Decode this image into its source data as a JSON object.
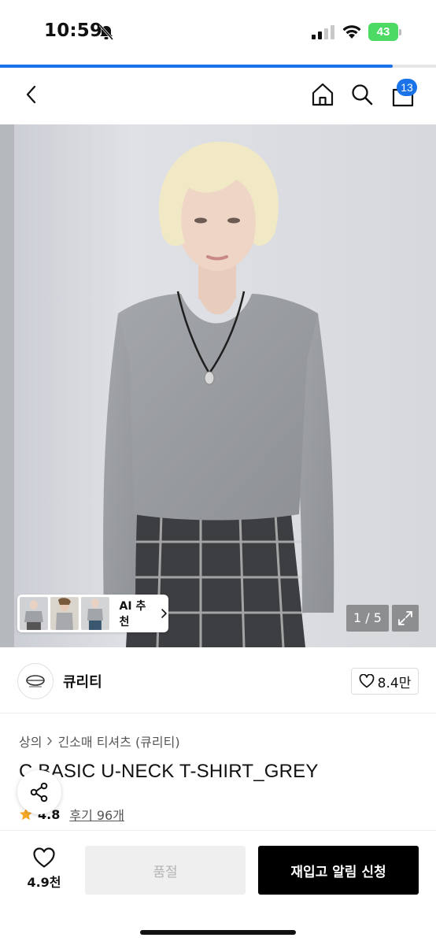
{
  "status_bar": {
    "time": "10:59",
    "battery": "43",
    "battery_color": "#4cd964"
  },
  "page_progress": 0.9,
  "nav": {
    "cart_count": "13",
    "accent_color": "#1a73e8",
    "icons": [
      "chevron-left-icon",
      "home-icon",
      "search-icon",
      "shopping-bag-icon"
    ]
  },
  "gallery": {
    "ai_label": "AI 추천",
    "page_indicator": "1 / 5"
  },
  "brand": {
    "name": "큐리티",
    "likes": "8.4만"
  },
  "breadcrumb": [
    "상의",
    "긴소매 티셔츠 (큐리티)"
  ],
  "product": {
    "title": "C BASIC U-NECK T-SHIRT_GREY",
    "rating": "4.8",
    "reviews": "후기 96개",
    "star_color": "#f5a623"
  },
  "bottom_bar": {
    "wish_count": "4.9천",
    "soldout_label": "품절",
    "restock_label": "재입고 알림 신청"
  }
}
